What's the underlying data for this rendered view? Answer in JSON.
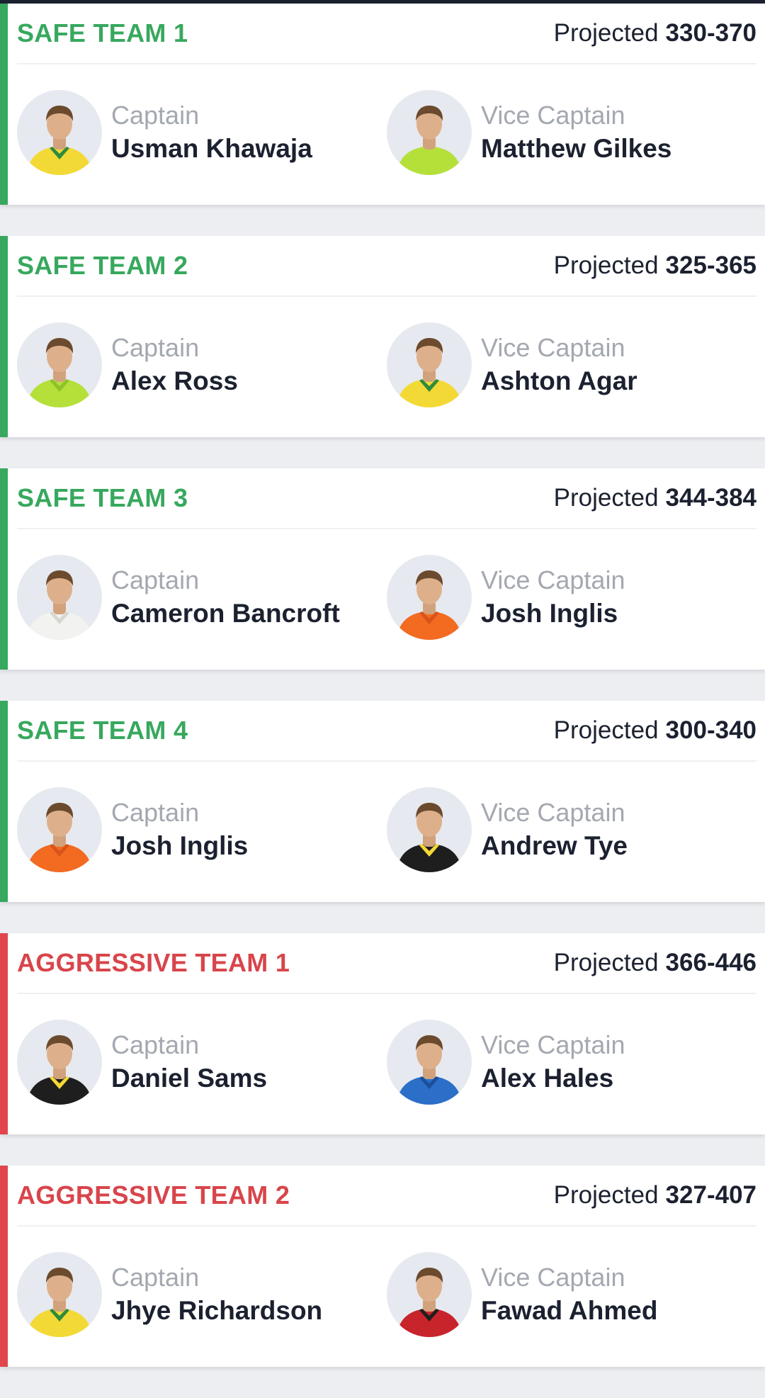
{
  "teams": [
    {
      "name": "SAFE TEAM 1",
      "kind": "safe",
      "projected_label": "Projected",
      "projected_range": "330-370",
      "captain": {
        "role": "Captain",
        "name": "Usman Khawaja",
        "jersey": "#f3d935",
        "trim": "#2e8b3c"
      },
      "vice_captain": {
        "role": "Vice Captain",
        "name": "Matthew Gilkes",
        "jersey": "#b5e03a",
        "trim": "#b5e03a"
      }
    },
    {
      "name": "SAFE TEAM 2",
      "kind": "safe",
      "projected_label": "Projected",
      "projected_range": "325-365",
      "captain": {
        "role": "Captain",
        "name": "Alex Ross",
        "jersey": "#b5e03a",
        "trim": "#8fc22a"
      },
      "vice_captain": {
        "role": "Vice Captain",
        "name": "Ashton Agar",
        "jersey": "#f3d935",
        "trim": "#2e8b3c"
      }
    },
    {
      "name": "SAFE TEAM 3",
      "kind": "safe",
      "projected_label": "Projected",
      "projected_range": "344-384",
      "captain": {
        "role": "Captain",
        "name": "Cameron Bancroft",
        "jersey": "#f2f2f0",
        "trim": "#d7d7d2"
      },
      "vice_captain": {
        "role": "Vice Captain",
        "name": "Josh Inglis",
        "jersey": "#f26b21",
        "trim": "#d9531a"
      }
    },
    {
      "name": "SAFE TEAM 4",
      "kind": "safe",
      "projected_label": "Projected",
      "projected_range": "300-340",
      "captain": {
        "role": "Captain",
        "name": "Josh Inglis",
        "jersey": "#f26b21",
        "trim": "#d9531a"
      },
      "vice_captain": {
        "role": "Vice Captain",
        "name": "Andrew Tye",
        "jersey": "#1e1e1e",
        "trim": "#f3d935"
      }
    },
    {
      "name": "AGGRESSIVE TEAM 1",
      "kind": "aggr",
      "projected_label": "Projected",
      "projected_range": "366-446",
      "captain": {
        "role": "Captain",
        "name": "Daniel Sams",
        "jersey": "#1e1e1e",
        "trim": "#f3d935"
      },
      "vice_captain": {
        "role": "Vice Captain",
        "name": "Alex Hales",
        "jersey": "#2b6fc9",
        "trim": "#1d4f9a"
      }
    },
    {
      "name": "AGGRESSIVE TEAM 2",
      "kind": "aggr",
      "projected_label": "Projected",
      "projected_range": "327-407",
      "captain": {
        "role": "Captain",
        "name": "Jhye Richardson",
        "jersey": "#f3d935",
        "trim": "#2e8b3c"
      },
      "vice_captain": {
        "role": "Vice Captain",
        "name": "Fawad Ahmed",
        "jersey": "#c8242c",
        "trim": "#1e1e1e"
      }
    }
  ]
}
